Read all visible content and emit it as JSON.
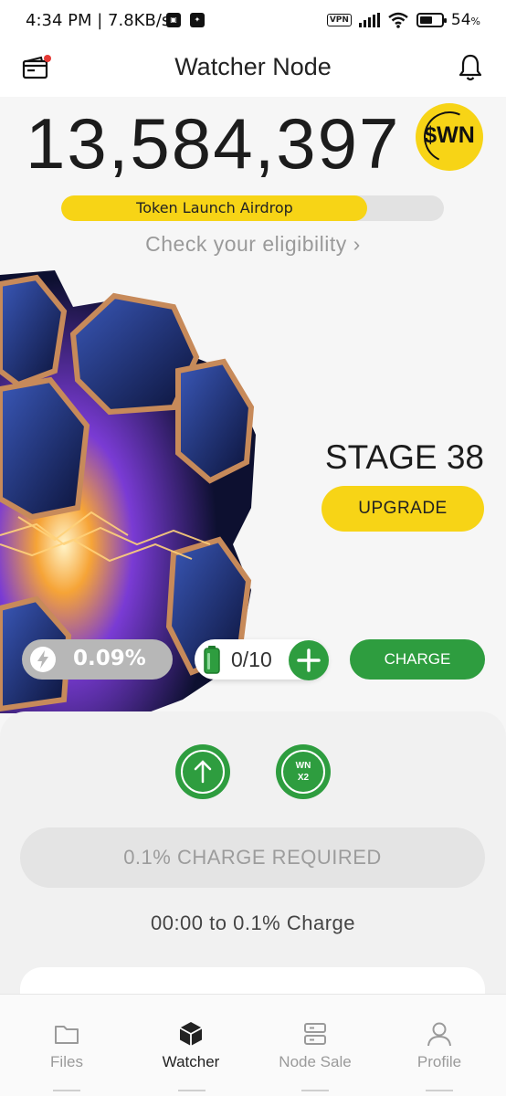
{
  "status_bar": {
    "time_speed": "4:34 PM | 7.8KB/s",
    "vpn": "VPN",
    "battery_percent": "54",
    "battery_unit": "%"
  },
  "header": {
    "title": "Watcher Node",
    "left_icon": "wallet-icon",
    "right_icon": "bell-icon"
  },
  "balance": {
    "amount": "13,584,397",
    "token": "$WN"
  },
  "airdrop": {
    "label": "Token Launch Airdrop",
    "progress": 0.8
  },
  "eligibility": {
    "text": "Check your eligibility",
    "chevron": "›"
  },
  "stage": {
    "label": "STAGE 38",
    "upgrade": "UPGRADE"
  },
  "controls": {
    "rate": "0.09%",
    "battery_count": "0/10",
    "charge": "CHARGE"
  },
  "card": {
    "boost_wn_line1": "WN",
    "boost_wn_line2": "X2",
    "required": "0.1% CHARGE REQUIRED",
    "timer": "00:00 to 0.1% Charge"
  },
  "nav": {
    "items": [
      {
        "label": "Files",
        "icon": "folder-icon"
      },
      {
        "label": "Watcher",
        "icon": "cube-icon"
      },
      {
        "label": "Node Sale",
        "icon": "server-icon"
      },
      {
        "label": "Profile",
        "icon": "user-icon"
      }
    ],
    "active": 1
  },
  "colors": {
    "accent_yellow": "#f7d416",
    "accent_green": "#2e9d3f",
    "background": "#f6f6f6"
  }
}
